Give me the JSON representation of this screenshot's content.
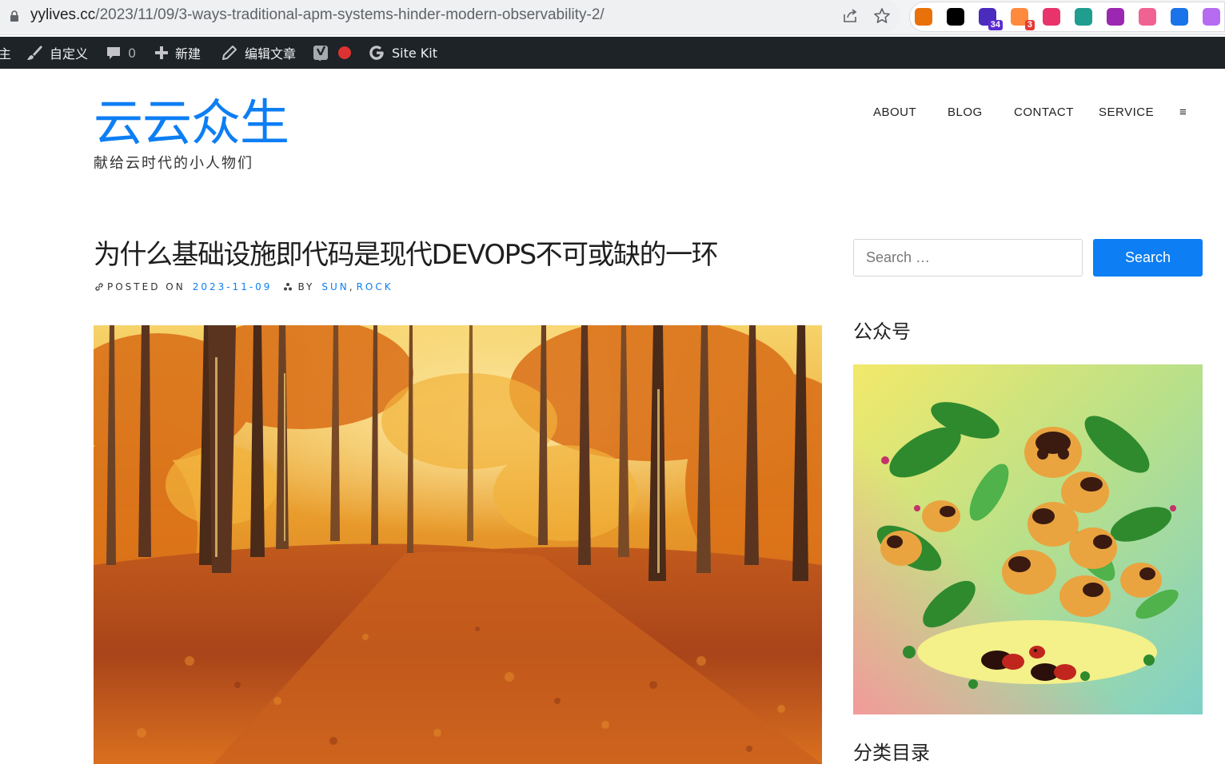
{
  "browser": {
    "url_host": "yylives.cc",
    "url_path": "/2023/11/09/3-ways-traditional-apm-systems-hinder-modern-observability-2/",
    "icons": [
      "lock-icon",
      "share-icon",
      "bookmark-star-icon"
    ],
    "extensions": [
      {
        "name": "record-extension-icon",
        "color": "#e8710a"
      },
      {
        "name": "notion-extension-icon",
        "color": "#000000"
      },
      {
        "name": "graduation-extension-icon",
        "color": "#4b2bbd",
        "badge": "34",
        "badge_color": "#5b2bd1"
      },
      {
        "name": "orange-extension-icon",
        "color": "#ff8a3d",
        "badge": "3",
        "badge_color": "#e53935"
      },
      {
        "name": "translate-extension-icon",
        "color": "#e8336b"
      },
      {
        "name": "net-extension-icon",
        "color": "#1f9d8f"
      },
      {
        "name": "purple-extension-icon",
        "color": "#9c27b0"
      },
      {
        "name": "cloud-extension-icon",
        "color": "#f06292"
      },
      {
        "name": "blue-extension-icon",
        "color": "#1a73e8"
      },
      {
        "name": "openai-extension-icon",
        "color": "#b56cf0"
      }
    ]
  },
  "admin_bar": {
    "home_fragment": "主",
    "customize": "自定义",
    "comments_count": "0",
    "new": "新建",
    "edit_post": "编辑文章",
    "site_kit": "Site Kit"
  },
  "site": {
    "title": "云云众生",
    "description": "献给云时代的小人物们",
    "accent": "#0d7ef3"
  },
  "nav": {
    "items": [
      "ABOUT",
      "BLOG",
      "CONTACT",
      "SERVICE"
    ],
    "menu_toggle": "≡"
  },
  "post": {
    "title": "为什么基础设施即代码是现代DEVOPS不可或缺的一环",
    "posted_on_label": "POSTED ON",
    "date": "2023-11-09",
    "by_label": "BY",
    "author": "SUN",
    "separator": ",",
    "author2": "ROCK"
  },
  "sidebar": {
    "search_placeholder": "Search …",
    "search_button": "Search",
    "widget_wechat": "公众号",
    "widget_categories": "分类目录"
  }
}
